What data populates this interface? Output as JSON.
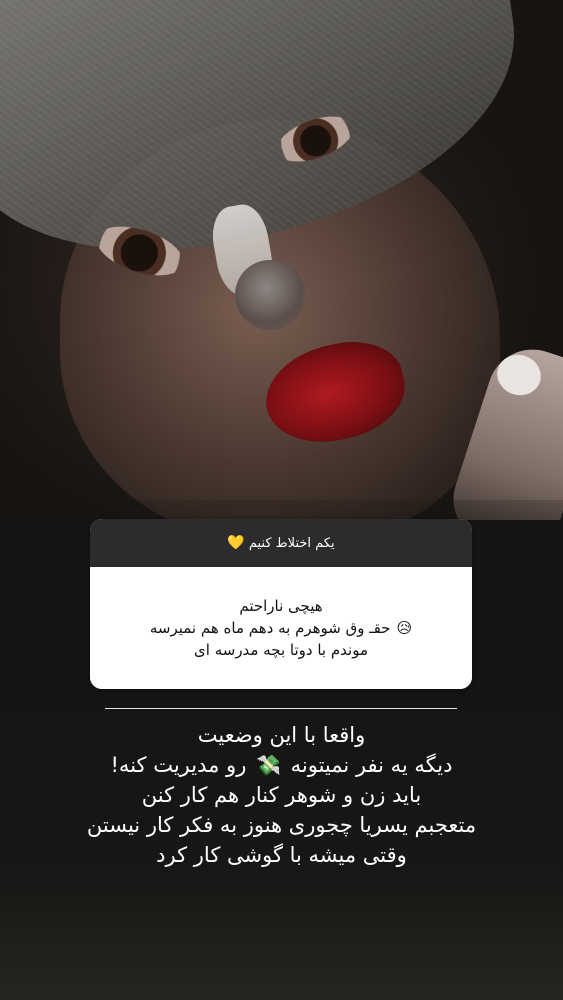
{
  "story": {
    "question_box": {
      "header": "یکم اختلاط کنیم",
      "header_emoji": "💛",
      "answer_lines": [
        "هیچی ناراحتم",
        "حقـ وق شوهرم به دهم ماه هم نمیرسه",
        "موندم با دوتا بچه مدرسه ای"
      ],
      "answer_emoji": "😥"
    },
    "caption_lines": {
      "l1": "واقعا با این وضعیت",
      "l2_before": "دیگه یه نفر نمیتونه",
      "l2_emoji": "💸",
      "l2_after": "رو مدیریت کنه!",
      "l3": "باید زن و شوهر کنار هم کار کنن",
      "l4": "متعجبم یسریا چجوری هنوز به فکر کار نیستن",
      "l5": "وقتی میشه با گوشی کار کرد"
    }
  }
}
